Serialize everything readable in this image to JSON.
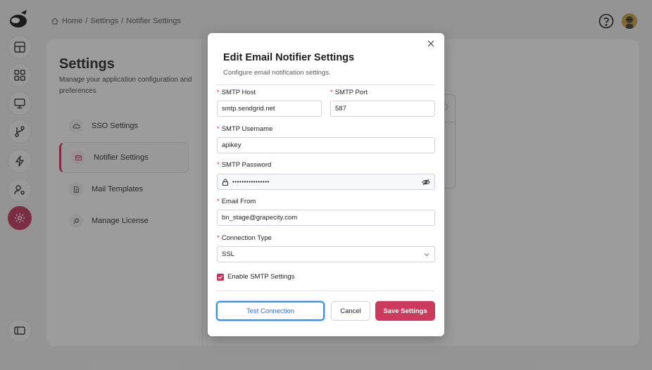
{
  "breadcrumb": {
    "home": "Home",
    "sep1": "/",
    "settings": "Settings",
    "sep2": "/",
    "current": "Notifier Settings"
  },
  "settings_panel": {
    "title": "Settings",
    "description": "Manage your application configuration and preferences",
    "menu": [
      {
        "label": "SSO Settings",
        "icon": "cloud-icon"
      },
      {
        "label": "Notifier Settings",
        "icon": "mail-icon",
        "active": true
      },
      {
        "label": "Mail Templates",
        "icon": "document-icon"
      },
      {
        "label": "Manage License",
        "icon": "search-icon"
      }
    ]
  },
  "rail_icons": [
    "dashboard-icon",
    "grid-icon",
    "monitor-icon",
    "git-branch-icon",
    "lightning-icon",
    "user-settings-icon",
    "gear-icon",
    "sidebar-toggle-icon"
  ],
  "colors": {
    "accent": "#c2345b",
    "required": "#d0344a",
    "focus": "#3c8fdd"
  },
  "modal": {
    "title": "Edit Email Notifier Settings",
    "subtitle": "Configure email notification settings.",
    "required_mark": "*",
    "fields": {
      "smtp_host": {
        "label": "SMTP Host",
        "value": "smtp.sendgrid.net"
      },
      "smtp_port": {
        "label": "SMTP Port",
        "value": "587"
      },
      "smtp_username": {
        "label": "SMTP Username",
        "value": "apikey"
      },
      "smtp_password": {
        "label": "SMTP Password",
        "value": "••••••••••••••••"
      },
      "email_from": {
        "label": "Email From",
        "value": "bn_stage@grapecity.com"
      },
      "connection_type": {
        "label": "Connection Type",
        "value": "SSL"
      }
    },
    "enable_smtp": {
      "label": "Enable SMTP Settings",
      "checked": true
    },
    "buttons": {
      "test": "Test Connection",
      "cancel": "Cancel",
      "save": "Save Settings"
    }
  }
}
